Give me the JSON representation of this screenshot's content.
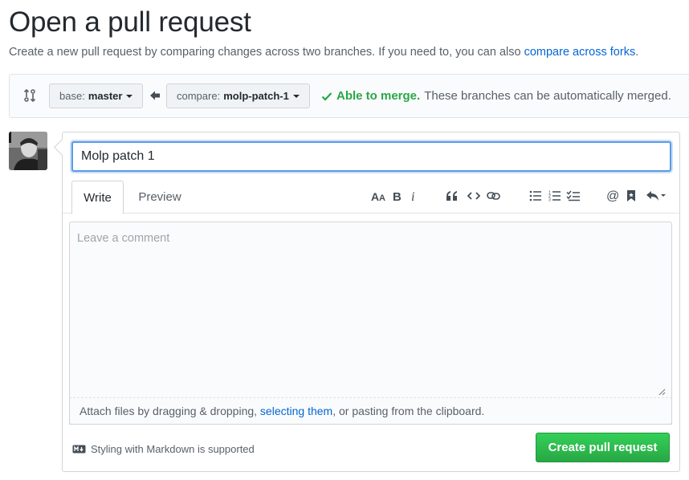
{
  "header": {
    "title": "Open a pull request",
    "subtitle": "Create a new pull request by comparing changes across two branches. If you need to, you can also",
    "compare_forks_link": "compare across forks",
    "subtitle_end": "."
  },
  "range": {
    "base_label": "base:",
    "base_branch": "master",
    "compare_label": "compare:",
    "compare_branch": "molp-patch-1",
    "merge_ok": "Able to merge.",
    "merge_note": "These branches can be automatically merged."
  },
  "composer": {
    "title_value": "Molp patch 1",
    "tabs": [
      {
        "label": "Write"
      },
      {
        "label": "Preview"
      }
    ],
    "comment_placeholder": "Leave a comment",
    "attach_prefix": "Attach files by dragging & dropping, ",
    "attach_link": "selecting them",
    "attach_suffix": ", or pasting from the clipboard.",
    "markdown_note": "Styling with Markdown is supported",
    "submit_label": "Create pull request"
  },
  "colors": {
    "accent_link": "#0366d6",
    "success": "#28a745",
    "button_green": "#2ea44f"
  },
  "icons": {
    "compare": "compare-icon",
    "arrow": "arrow-left-icon",
    "check": "check-icon",
    "toolbar": [
      "text-size-icon",
      "bold-icon",
      "italic-icon",
      "quote-icon",
      "code-icon",
      "link-icon",
      "unordered-list-icon",
      "ordered-list-icon",
      "task-list-icon",
      "mention-icon",
      "bookmark-icon",
      "reply-icon"
    ],
    "markdown": "markdown-icon"
  }
}
